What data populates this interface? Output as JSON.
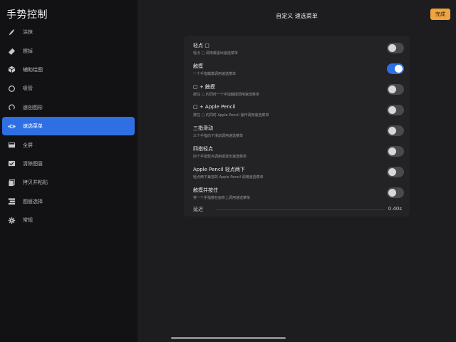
{
  "sidebar": {
    "title": "手势控制",
    "items": [
      {
        "label": "涂抹",
        "icon": "smudge-brush-icon",
        "active": false
      },
      {
        "label": "擦掉",
        "icon": "eraser-icon",
        "active": false
      },
      {
        "label": "辅助绘图",
        "icon": "cube-icon",
        "active": false
      },
      {
        "label": "吸管",
        "icon": "eyedropper-circle-icon",
        "active": false
      },
      {
        "label": "速创图形",
        "icon": "quickshape-icon",
        "active": false
      },
      {
        "label": "速选菜单",
        "icon": "quickmenu-icon",
        "active": true
      },
      {
        "label": "全屏",
        "icon": "fullscreen-icon",
        "active": false
      },
      {
        "label": "清除图层",
        "icon": "clear-layer-icon",
        "active": false
      },
      {
        "label": "拷贝并粘贴",
        "icon": "copy-paste-icon",
        "active": false
      },
      {
        "label": "图层选择",
        "icon": "layer-select-icon",
        "active": false
      },
      {
        "label": "常规",
        "icon": "gear-icon",
        "active": false
      }
    ]
  },
  "header": {
    "title": "自定义 速选菜单",
    "done_label": "完成"
  },
  "settings": [
    {
      "title": "轻点 ▢",
      "desc": "轻点 ▢ 调用或退出速选菜单",
      "on": false
    },
    {
      "title": "触摸",
      "desc": "一个手指触摸调用速选菜单",
      "on": true
    },
    {
      "title": "▢ + 触摸",
      "desc": "按住 ▢ 的同时一个手指触摸调用速选菜单",
      "on": false
    },
    {
      "title": "▢ + Apple Pencil",
      "desc": "按住 ▢ 的同时 Apple Pencil 操作调用速选菜单",
      "on": false
    },
    {
      "title": "三指滑动",
      "desc": "三个手指向下滑动调用速选菜单",
      "on": false
    },
    {
      "title": "四指轻点",
      "desc": "四个手指轻点调用或退出速选菜单",
      "on": false
    },
    {
      "title": "Apple Pencil 轻点两下",
      "desc": "轻点两下兼容的 Apple Pencil 调用速选菜单",
      "on": false
    },
    {
      "title": "触摸并按住",
      "desc": "将一个手指按在画布上调用速选菜单",
      "on": false
    }
  ],
  "delay": {
    "label": "延迟",
    "value": "0.40s"
  },
  "colors": {
    "accent": "#2f6fe4",
    "done_button": "#f1a33c"
  }
}
